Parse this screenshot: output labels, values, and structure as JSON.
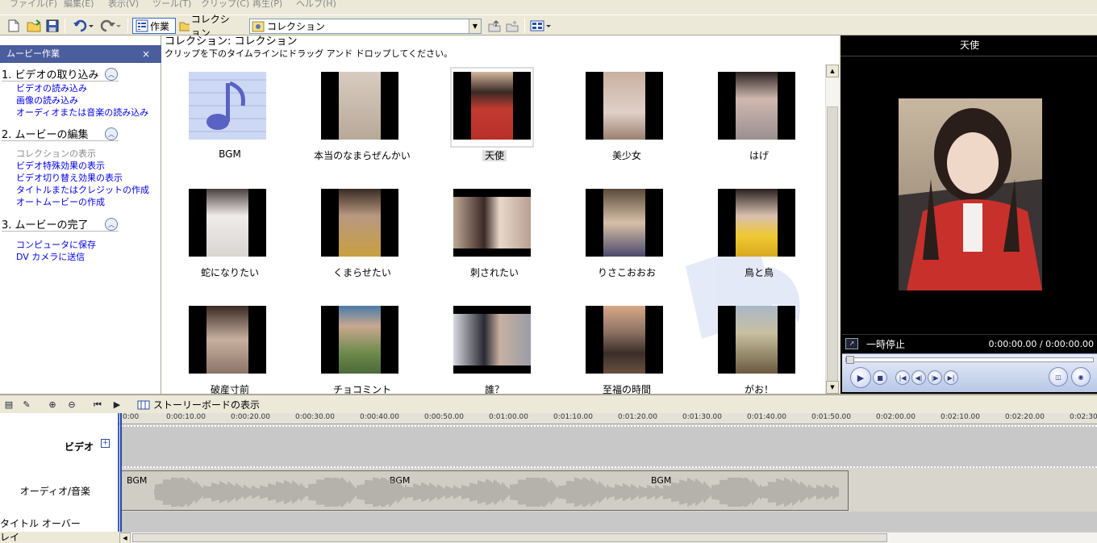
{
  "menu": [
    "ファイル(F)",
    "編集(E)",
    "表示(V)",
    "ツール(T)",
    "クリップ(C)",
    "再生(P)",
    "ヘルプ(H)"
  ],
  "toolbar": {
    "tasks_label": "作業",
    "collections_label": "コレクション",
    "combo_value": "コレクション"
  },
  "taskpane": {
    "title": "ムービー作業",
    "close": "×",
    "sections": [
      {
        "title": "1. ビデオの取り込み",
        "links": [
          "ビデオの読み込み",
          "画像の読み込み",
          "オーディオまたは音楽の読み込み"
        ]
      },
      {
        "title": "2. ムービーの編集",
        "links": [
          "コレクションの表示",
          "ビデオ特殊効果の表示",
          "ビデオ切り替え効果の表示",
          "タイトルまたはクレジットの作成",
          "オートムービーの作成"
        ]
      },
      {
        "title": "3. ムービーの完了",
        "links": [
          "コンピュータに保存",
          "DV カメラに送信"
        ]
      }
    ]
  },
  "collection": {
    "title": "コレクション: コレクション",
    "subtitle": "クリップを下のタイムラインにドラッグ アンド ドロップしてください。",
    "clips": [
      {
        "label": "BGM",
        "kind": "audio"
      },
      {
        "label": "本当のなまらぜんかい",
        "kind": "photo",
        "color": "#c9b8a8"
      },
      {
        "label": "天使",
        "kind": "photo",
        "color": "#b83c34",
        "selected": true
      },
      {
        "label": "美少女",
        "kind": "photo",
        "color": "#b59a8a"
      },
      {
        "label": "はげ",
        "kind": "photo",
        "color": "#a88f86"
      },
      {
        "label": "蛇になりたい",
        "kind": "photo",
        "color": "#d8d4d0"
      },
      {
        "label": "くまらせたい",
        "kind": "photo",
        "color": "#7a6452"
      },
      {
        "label": "刺されたい",
        "kind": "wide",
        "color": "#a08070"
      },
      {
        "label": "りさこおおお",
        "kind": "photo",
        "color": "#6d5a4a"
      },
      {
        "label": "鳥と鳥",
        "kind": "photo",
        "color": "#e0c04a"
      },
      {
        "label": "破産寸前",
        "kind": "photo",
        "color": "#8a7468"
      },
      {
        "label": "チョコミント",
        "kind": "photo",
        "color": "#6d8a5a"
      },
      {
        "label": "誰？",
        "kind": "wide",
        "color": "#7a7c88"
      },
      {
        "label": "至福の時間",
        "kind": "photo",
        "color": "#9a7a62"
      },
      {
        "label": "がお！",
        "kind": "photo",
        "color": "#a8a080"
      }
    ]
  },
  "preview": {
    "title": "天使",
    "status": "一時停止",
    "time": "0:00:00.00 / 0:00:00.00"
  },
  "timeline": {
    "storyboard_label": "ストーリーボードの表示",
    "ticks": [
      "0:00",
      "0:00:10.00",
      "0:00:20.00",
      "0:00:30.00",
      "0:00:40.00",
      "0:00:50.00",
      "0:01:00.00",
      "0:01:10.00",
      "0:01:20.00",
      "0:01:30.00",
      "0:01:40.00",
      "0:01:50.00",
      "0:02:00.00",
      "0:02:10.00",
      "0:02:20.00",
      "0:02:30"
    ],
    "tracks": {
      "video": "ビデオ",
      "audio": "オーディオ/音楽",
      "title": "タイトル オーバーレイ"
    },
    "audio_clip_labels": [
      "BGM",
      "BGM",
      "BGM"
    ]
  }
}
